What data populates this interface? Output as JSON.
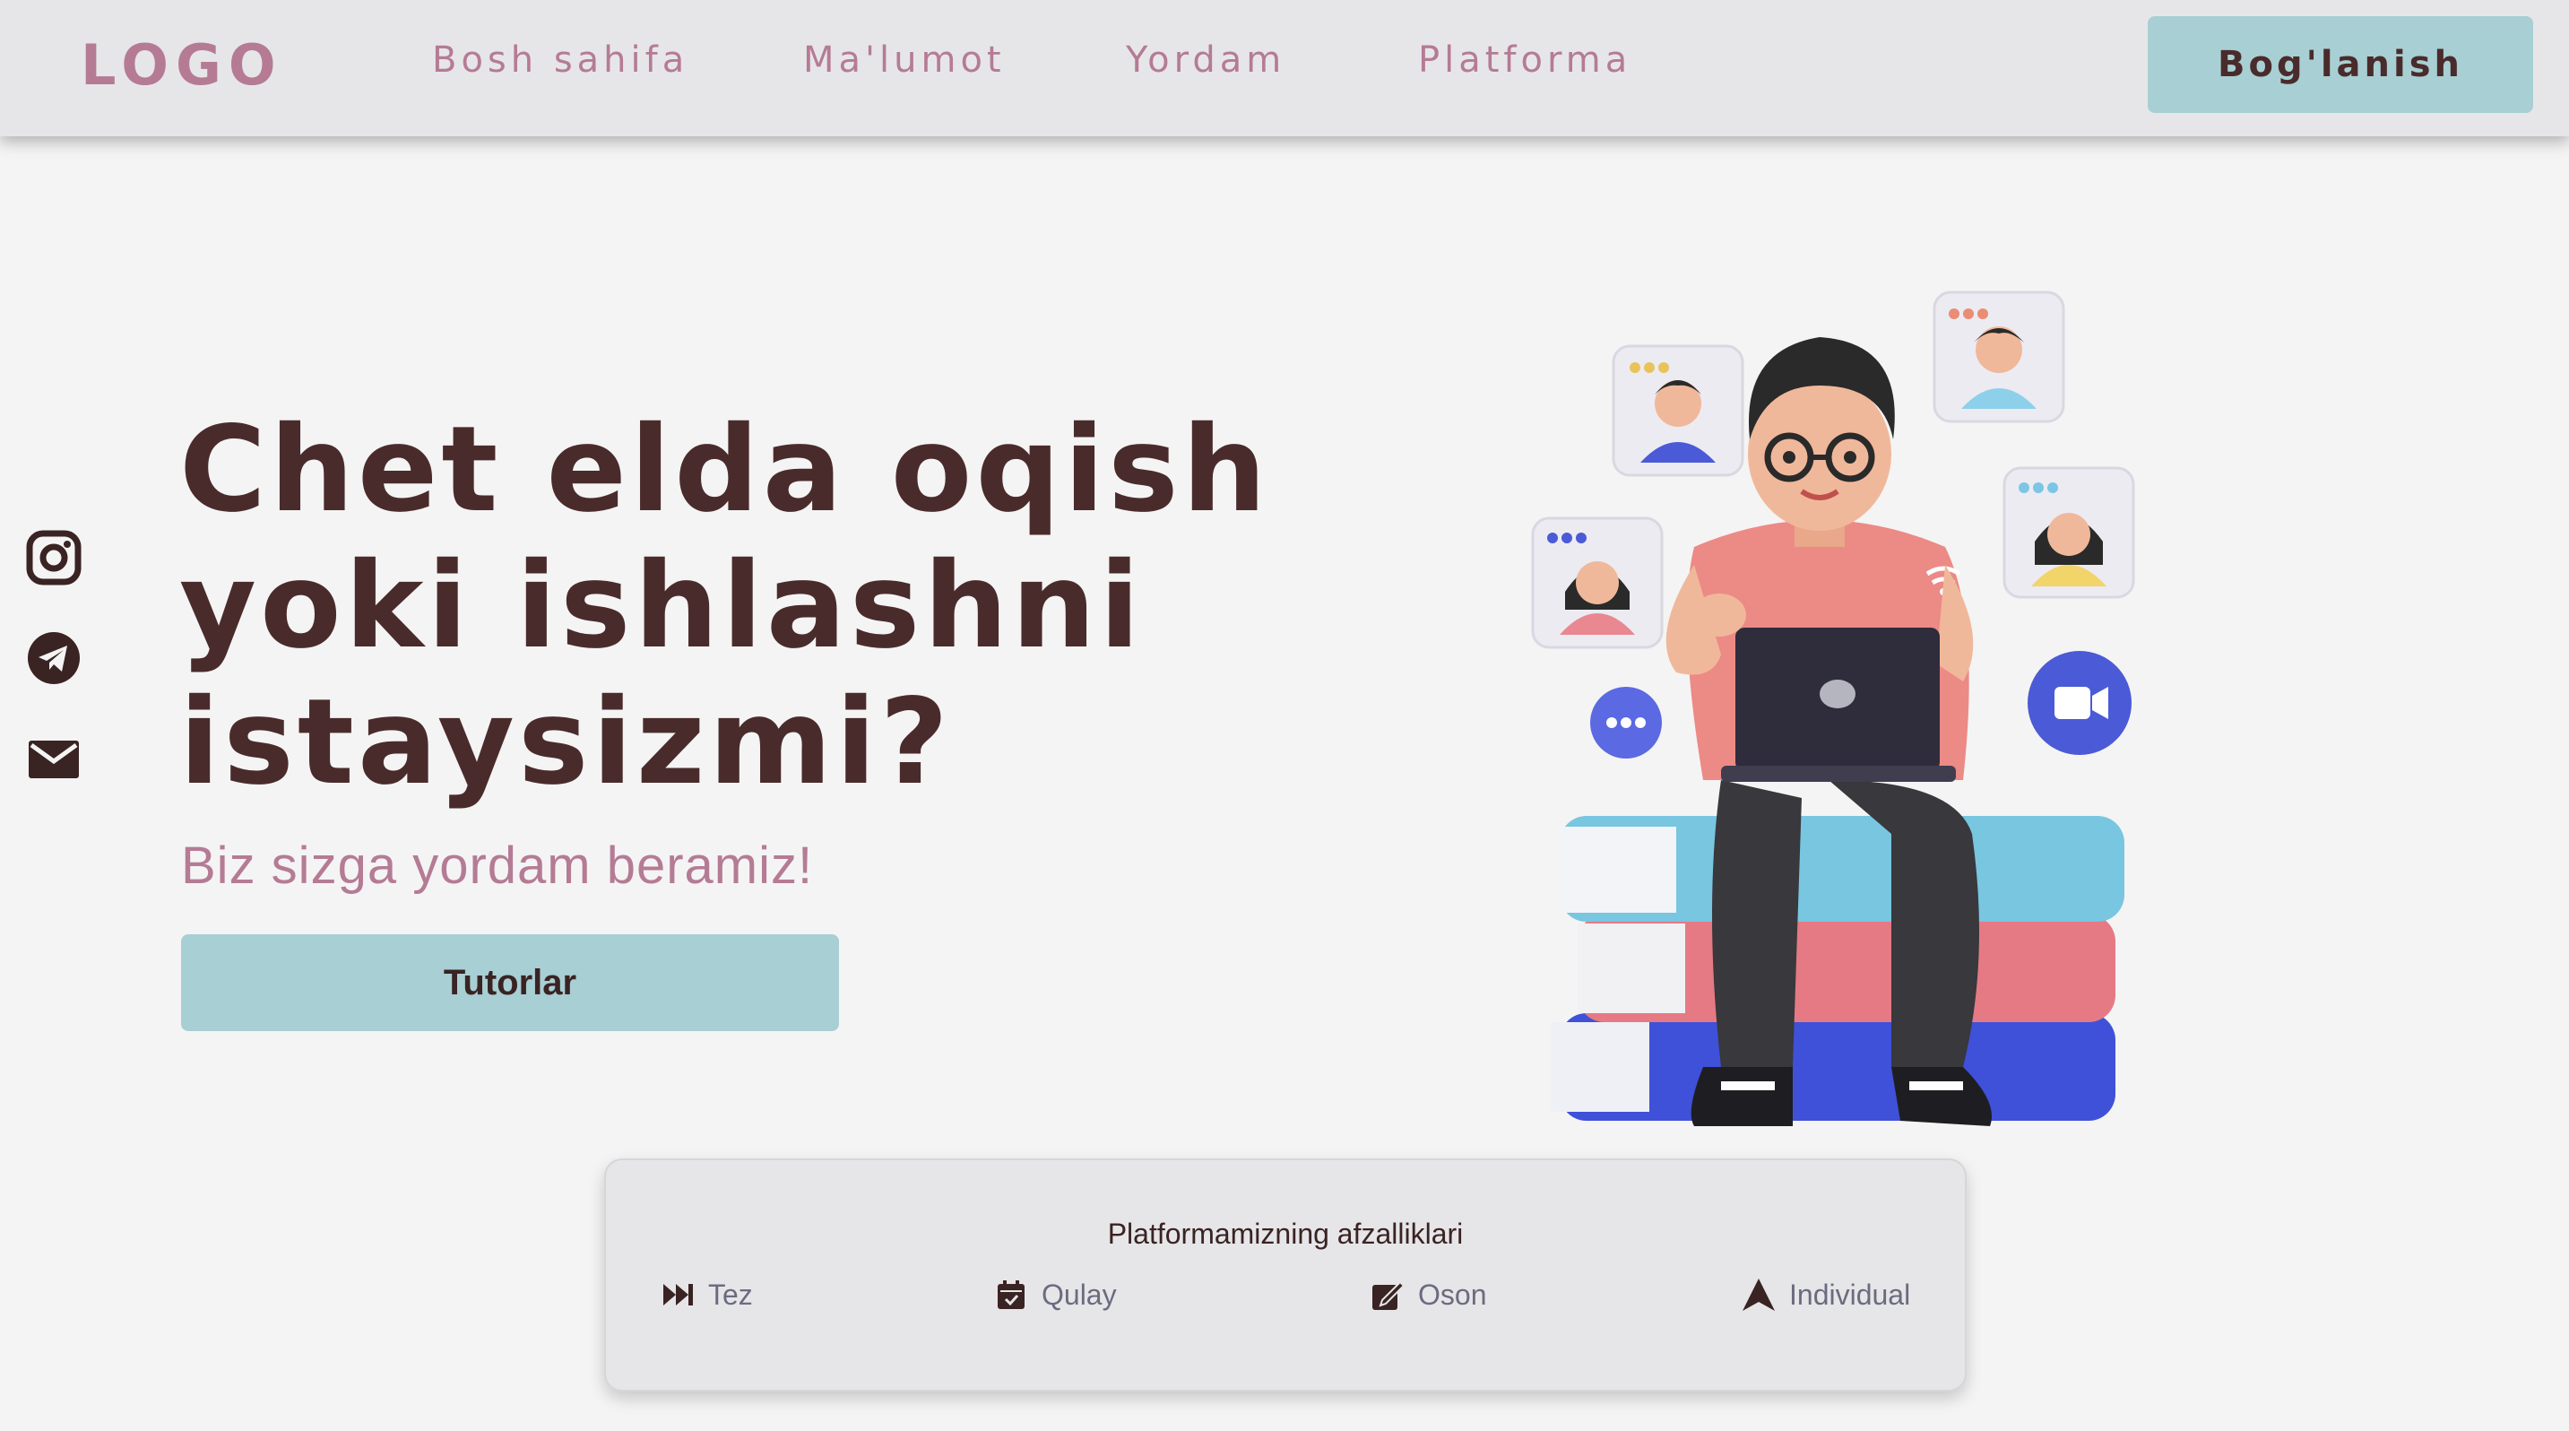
{
  "nav": {
    "logo": "LOGO",
    "links": [
      "Bosh sahifa",
      "Ma'lumot",
      "Yordam",
      "Platforma"
    ],
    "contact": "Bog'lanish"
  },
  "social": [
    {
      "icon": "instagram-icon"
    },
    {
      "icon": "telegram-icon"
    },
    {
      "icon": "mail-icon"
    }
  ],
  "hero": {
    "title_lines": [
      "Chet elda oqish",
      "yoki ishlashni",
      "istaysizmi?"
    ],
    "subtitle": "Biz sizga yordam beramiz!",
    "button": "Tutorlar"
  },
  "features": {
    "title": "Platformamizning afzalliklari",
    "items": [
      {
        "label": "Tez",
        "icon": "fast-forward-icon"
      },
      {
        "label": "Qulay",
        "icon": "calendar-icon"
      },
      {
        "label": "Oson",
        "icon": "edit-icon"
      },
      {
        "label": "Individual",
        "icon": "arrow-up-icon"
      }
    ]
  },
  "colors": {
    "accent": "#a8cfd3",
    "pink": "#b57b95",
    "dark": "#4a2b2b",
    "background": "#f4f4f4",
    "nav_bg": "#e6e6e8"
  }
}
